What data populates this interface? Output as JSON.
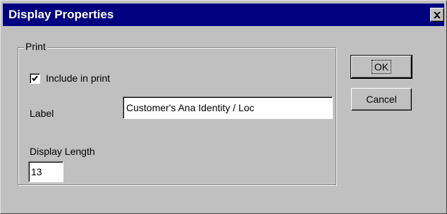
{
  "window": {
    "title": "Display Properties"
  },
  "print_group": {
    "label": "Print",
    "include_in_print": {
      "label": "Include in print",
      "checked": true
    },
    "label_field": {
      "label": "Label",
      "value": "Customer's Ana Identity / Loc"
    },
    "display_length": {
      "label": "Display Length",
      "value": "13"
    }
  },
  "buttons": {
    "ok_label": "OK",
    "cancel_label": "Cancel"
  },
  "icons": {
    "close": "close-icon",
    "check": "checkmark-icon"
  },
  "colors": {
    "titlebar": "#000080",
    "dialog_face": "#c0c0c0",
    "title_text": "#ffffff"
  }
}
